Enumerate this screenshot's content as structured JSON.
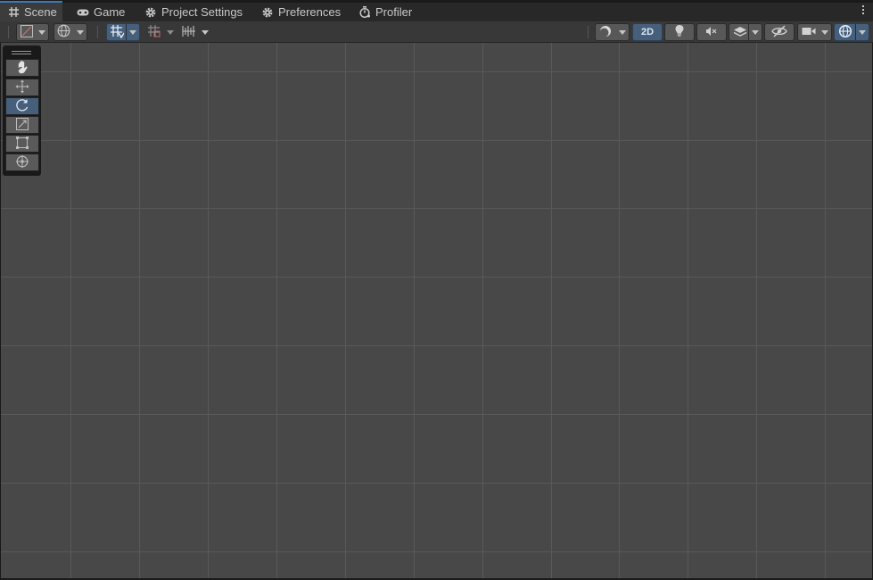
{
  "tabs": [
    {
      "label": "Scene",
      "icon": "grid-hash-icon",
      "active": true
    },
    {
      "label": "Game",
      "icon": "gamepad-icon",
      "active": false
    },
    {
      "label": "Project Settings",
      "icon": "gear-icon",
      "active": false
    },
    {
      "label": "Preferences",
      "icon": "gear-icon",
      "active": false
    },
    {
      "label": "Profiler",
      "icon": "stopwatch-icon",
      "active": false
    }
  ],
  "toolbar": {
    "left": [
      {
        "name": "draw-mode-dropdown",
        "icon": "shaded-box-icon"
      },
      {
        "name": "global-local-dropdown",
        "icon": "globe-icon"
      },
      {
        "name": "grid-snapping-toggle",
        "icon": "grid-snap-icon",
        "active": true
      },
      {
        "name": "increment-snap-dropdown",
        "icon": "snap-increment-icon"
      },
      {
        "name": "ruler-dropdown",
        "icon": "ruler-icon"
      }
    ],
    "right": [
      {
        "name": "shading-mode-dropdown",
        "icon": "sphere-icon"
      },
      {
        "name": "toggle-2d-button",
        "label": "2D",
        "active": true
      },
      {
        "name": "lighting-toggle",
        "icon": "bulb-icon"
      },
      {
        "name": "audio-toggle",
        "icon": "mute-speaker-icon"
      },
      {
        "name": "effects-dropdown",
        "icon": "layers-icon"
      },
      {
        "name": "scene-visibility-toggle",
        "icon": "hidden-eye-icon"
      },
      {
        "name": "camera-dropdown",
        "icon": "camera-icon"
      },
      {
        "name": "gizmos-dropdown",
        "icon": "gizmo-globe-icon",
        "active": true
      }
    ]
  },
  "tools": [
    {
      "name": "hand-tool",
      "icon": "hand-icon",
      "active": false
    },
    {
      "name": "move-tool",
      "icon": "move-arrows-icon",
      "active": false
    },
    {
      "name": "rotate-tool",
      "icon": "rotate-icon",
      "active": true
    },
    {
      "name": "scale-tool",
      "icon": "scale-icon",
      "active": false
    },
    {
      "name": "rect-tool",
      "icon": "rect-icon",
      "active": false
    },
    {
      "name": "transform-tool",
      "icon": "transform-icon",
      "active": false
    }
  ],
  "colors": {
    "accent": "#3a79bb",
    "active_button": "#46607c",
    "viewport_bg": "#484848",
    "grid_line": "#595959"
  }
}
